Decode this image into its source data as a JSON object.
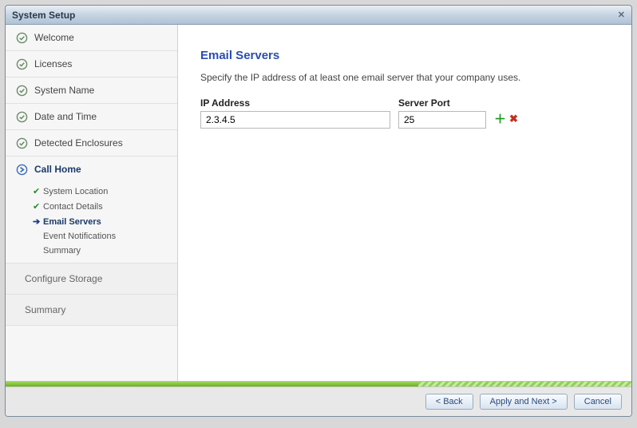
{
  "window": {
    "title": "System Setup"
  },
  "sidebar": {
    "items": [
      {
        "label": "Welcome"
      },
      {
        "label": "Licenses"
      },
      {
        "label": "System Name"
      },
      {
        "label": "Date and Time"
      },
      {
        "label": "Detected Enclosures"
      },
      {
        "label": "Call Home"
      }
    ],
    "callhome_subitems": [
      {
        "label": "System Location",
        "state": "done"
      },
      {
        "label": "Contact Details",
        "state": "done"
      },
      {
        "label": "Email Servers",
        "state": "current"
      },
      {
        "label": "Event Notifications",
        "state": "pending"
      },
      {
        "label": "Summary",
        "state": "pending"
      }
    ],
    "future": [
      {
        "label": "Configure Storage"
      },
      {
        "label": "Summary"
      }
    ]
  },
  "main": {
    "title": "Email Servers",
    "description": "Specify the IP address of at least one email server that your company uses.",
    "ip_label": "IP Address",
    "port_label": "Server Port",
    "rows": [
      {
        "ip": "2.3.4.5",
        "port": "25"
      }
    ]
  },
  "footer": {
    "back": "< Back",
    "next": "Apply and Next >",
    "cancel": "Cancel"
  },
  "meta": {
    "progress_percent": 66
  }
}
